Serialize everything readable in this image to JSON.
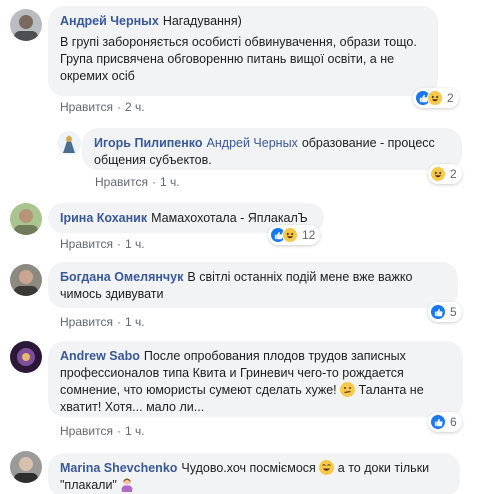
{
  "comments": [
    {
      "author": "Андрей Черных",
      "text": "Нагадування)\nВ групі забороняється особисті обвинувачення, образи тощо. Група присвячена обговоренню питань вищої освіти, а не окремих осіб",
      "like_label": "Нравится",
      "dot": "·",
      "time": "2 ч.",
      "reactions": [
        "like",
        "haha"
      ],
      "reaction_count": "2",
      "avatar_color": "#8a8f96"
    },
    {
      "author": "Игорь Пилипенко",
      "mention": "Андрей Черных",
      "text": "образование - процесс общения субъектов.",
      "like_label": "Нравится",
      "dot": "·",
      "time": "1 ч.",
      "reactions": [
        "haha"
      ],
      "reaction_count": "2",
      "avatar_color": "#6b8fb5"
    },
    {
      "author": "Ірина Коханик",
      "text": "Мамахохотала - ЯплакалЪ",
      "like_label": "Нравится",
      "dot": "·",
      "time": "1 ч.",
      "reactions": [
        "like",
        "haha"
      ],
      "reaction_count": "12",
      "avatar_color": "#7d9b6a"
    },
    {
      "author": "Богдана Омелянчук",
      "text": "В світлі останніх подій мене вже важко чимось здивувати",
      "like_label": "Нравится",
      "dot": "·",
      "time": "1 ч.",
      "reactions": [
        "like"
      ],
      "reaction_count": "5",
      "avatar_color": "#9a7e6b"
    },
    {
      "author": "Andrew Sabo",
      "text": "После опробования плодов трудов записных профессионалов типа Квита и Гриневич чего-то рождается сомнение, что юмористы сумеют сделать хуже!",
      "text_after": "Таланта не хватит! Хотя... мало ли...",
      "like_label": "Нравится",
      "dot": "·",
      "time": "1 ч.",
      "reactions": [
        "like"
      ],
      "reaction_count": "6",
      "avatar_color": "#5a3a6e"
    },
    {
      "author": "Marina Shevchenko",
      "text": "Чудово.хоч посміємося",
      "text_after": "а то доки тільки \"плакали\"",
      "avatar_color": "#707070"
    }
  ],
  "colors": {
    "link": "#385898",
    "bubble": "#f2f3f5",
    "like_blue": "#1877f2",
    "haha_yellow": "#f7c94b"
  }
}
